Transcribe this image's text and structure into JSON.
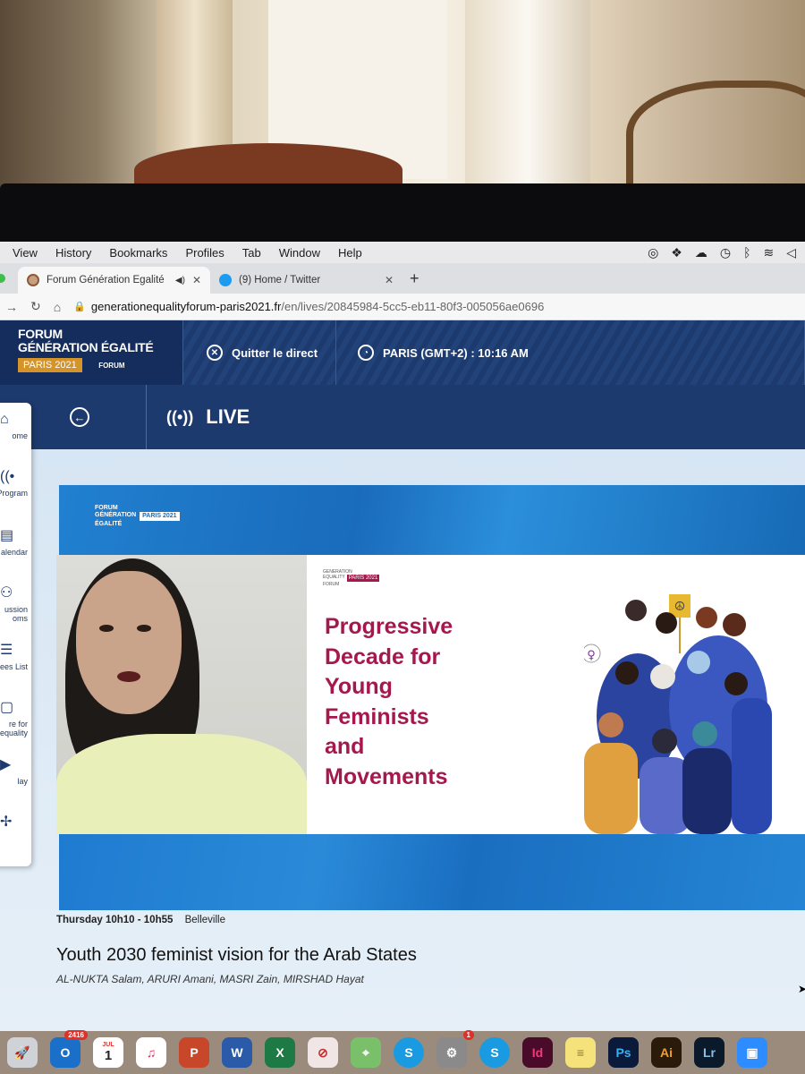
{
  "menubar": {
    "items": [
      "View",
      "History",
      "Bookmarks",
      "Profiles",
      "Tab",
      "Window",
      "Help"
    ]
  },
  "tabs": [
    {
      "title": "Forum Génération Égalité",
      "active": true
    },
    {
      "title": "(9) Home / Twitter",
      "active": false
    }
  ],
  "url": {
    "host": "generationequalityforum-paris2021.fr",
    "path": "/en/lives/20845984-5cc5-eb11-80f3-005056ae0696"
  },
  "header": {
    "brand_line1": "FORUM",
    "brand_line2": "GÉNÉRATION ÉGALITÉ",
    "brand_tag": "PARIS 2021",
    "brand_mini": "FORUM",
    "quit_label": "Quitter le direct",
    "clock_label": "PARIS (GMT+2) : 10:16 AM"
  },
  "subheader": {
    "live_label": "LIVE"
  },
  "sidebar": {
    "items": [
      {
        "label": "ome",
        "icon": "home-icon"
      },
      {
        "label": "Program",
        "icon": "broadcast-icon"
      },
      {
        "label": "alendar",
        "icon": "calendar-icon"
      },
      {
        "label": "ussion oms",
        "icon": "people-icon"
      },
      {
        "label": "ees List",
        "icon": "list-icon"
      },
      {
        "label": "re for equality",
        "icon": "document-icon"
      },
      {
        "label": "lay",
        "icon": "play-icon"
      },
      {
        "label": "",
        "icon": "more-icon"
      }
    ]
  },
  "video": {
    "banner_logo_line1": "FORUM",
    "banner_logo_line2": "GÉNÉRATION",
    "banner_logo_line3": "ÉGALITÉ",
    "banner_tag": "PARIS 2021",
    "slide_logo_line1": "GENERATION",
    "slide_logo_line2": "EQUALITY",
    "slide_logo_line3": "FORUM",
    "slide_tag": "PARIS 2021",
    "slide_title_lines": [
      "Progressive",
      "Decade for",
      "Young",
      "Feminists",
      "and",
      "Movements"
    ]
  },
  "session": {
    "time": "Thursday 10h10 - 10h55",
    "room": "Belleville",
    "title": "Youth 2030 feminist vision for the Arab States",
    "speakers": "AL-NUKTA Salam, ARURI Amani, MASRI Zain, MIRSHAD Hayat"
  },
  "dock": {
    "mail_badge": "2416",
    "calendar_month": "JUL",
    "calendar_day": "1",
    "prefs_badge": "1",
    "apps": [
      {
        "name": "rocket",
        "label": ""
      },
      {
        "name": "outlook",
        "label": "O"
      },
      {
        "name": "music",
        "label": "♫"
      },
      {
        "name": "powerpoint",
        "label": "P"
      },
      {
        "name": "word",
        "label": "W"
      },
      {
        "name": "excel",
        "label": "X"
      },
      {
        "name": "skype",
        "label": "S"
      },
      {
        "name": "indesign",
        "label": "Id"
      },
      {
        "name": "photoshop",
        "label": "Ps"
      },
      {
        "name": "illustrator",
        "label": "Ai"
      },
      {
        "name": "lightroom",
        "label": "Lr"
      }
    ]
  },
  "colors": {
    "navy": "#1d3a6e",
    "brand_blue": "#1e78c8",
    "magenta": "#a6174d",
    "gold": "#d4942a"
  }
}
